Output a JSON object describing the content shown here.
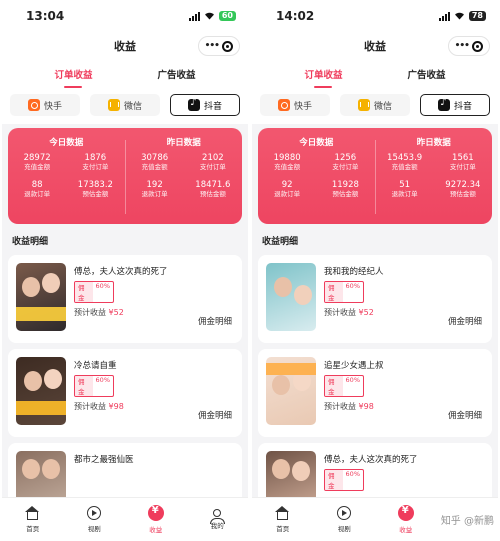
{
  "nav_title": "收益",
  "tabs": [
    "订单收益",
    "广告收益"
  ],
  "platforms": [
    "快手",
    "微信",
    "抖音"
  ],
  "stats_headers": {
    "today": "今日数据",
    "yesterday": "昨日数据"
  },
  "stat_labels": [
    "充值金额",
    "支付订单",
    "退款订单",
    "预估金额"
  ],
  "section_title": "收益明细",
  "commission_label": "佣金",
  "rate": "60%",
  "earn_label": "预计收益",
  "detail_label": "佣金明细",
  "bottom_nav": [
    "首页",
    "视剧",
    "收益",
    "我的"
  ],
  "watermark": "知乎 @新鹏",
  "colors": {
    "accent": "#ef3c5c",
    "stats_bg": "#f04a64"
  },
  "left": {
    "time": "13:04",
    "battery": "60",
    "today": [
      "28972",
      "1876",
      "88",
      "17383.2"
    ],
    "yesterday": [
      "30786",
      "2102",
      "192",
      "18471.6"
    ],
    "items": [
      {
        "title": "傅总，夫人这次真的死了",
        "amount": "¥52"
      },
      {
        "title": "冷总请自重",
        "amount": "¥98"
      },
      {
        "title": "都市之最强仙医",
        "amount": ""
      }
    ]
  },
  "right": {
    "time": "14:02",
    "battery": "78",
    "today": [
      "19880",
      "1256",
      "92",
      "11928"
    ],
    "yesterday": [
      "15453.9",
      "1561",
      "51",
      "9272.34"
    ],
    "items": [
      {
        "title": "我和我的经纪人",
        "amount": "¥52"
      },
      {
        "title": "追星少女遇上叔",
        "amount": "¥98"
      },
      {
        "title": "傅总，夫人这次真的死了",
        "amount": ""
      }
    ]
  }
}
